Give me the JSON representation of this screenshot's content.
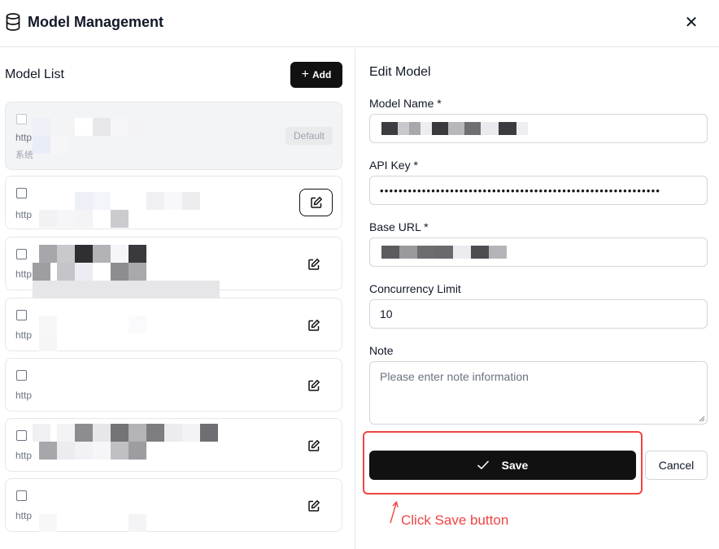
{
  "header": {
    "title": "Model Management",
    "close_glyph": "✕",
    "icons": {
      "title": "database-icon",
      "close": "close-icon"
    }
  },
  "list": {
    "title": "Model List",
    "add_label": "Add",
    "add_glyph": "+",
    "items": [
      {
        "url_prefix": "http",
        "sub_prefix": "系统",
        "badge": "Default",
        "selected": true
      },
      {
        "url_prefix": "http"
      },
      {
        "url_prefix": "http"
      },
      {
        "url_prefix": "http"
      },
      {
        "url_prefix": "http"
      },
      {
        "url_prefix": "http"
      },
      {
        "url_prefix": "http"
      }
    ]
  },
  "form": {
    "title": "Edit Model",
    "model_name_label": "Model Name *",
    "api_key_label": "API Key *",
    "api_key_value": "••••••••••••••••••••••••••••••••••••••••••••••••••••••••••••",
    "base_url_label": "Base URL *",
    "concurrency_label": "Concurrency Limit",
    "concurrency_value": "10",
    "note_label": "Note",
    "note_placeholder": "Please enter note information",
    "save_label": "Save",
    "save_icon": "check-icon",
    "cancel_label": "Cancel"
  },
  "annotation": {
    "text": "Click Save button",
    "color": "#ef4444"
  },
  "colors": {
    "primary": "#111111",
    "border": "#e5e7eb",
    "highlight": "#ef4444"
  }
}
